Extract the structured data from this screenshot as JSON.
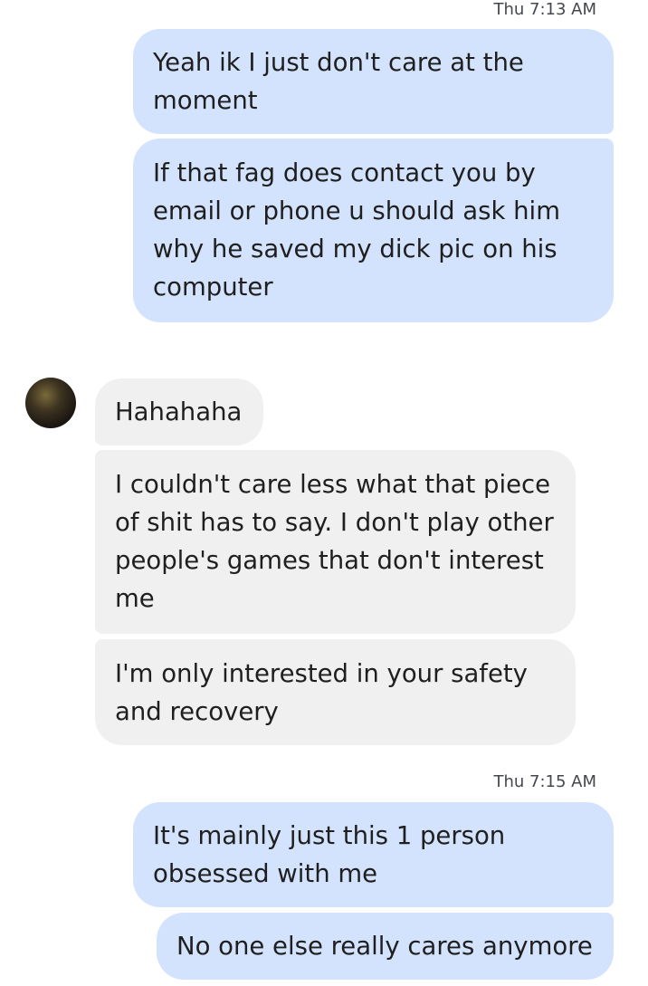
{
  "conversation": {
    "timestamps": [
      "Thu 7:13 AM",
      "Thu 7:15 AM"
    ],
    "messages": [
      {
        "direction": "outgoing",
        "text": "Yeah ik I just don't care at the moment"
      },
      {
        "direction": "outgoing",
        "text": "If that fag does contact you by email or phone u should ask him why he saved my dick pic on his computer"
      },
      {
        "direction": "incoming",
        "text": "Hahahaha"
      },
      {
        "direction": "incoming",
        "text": "I couldn't care less what that piece of shit has to say. I don't play other people's games that don't interest me"
      },
      {
        "direction": "incoming",
        "text": "I'm only interested in your safety and recovery"
      },
      {
        "direction": "outgoing",
        "text": "It's mainly just this 1 person obsessed with me"
      },
      {
        "direction": "outgoing",
        "text": "No one else really cares anymore"
      }
    ],
    "contact_avatar_icon": "contact-avatar-photo"
  },
  "colors": {
    "outgoing_bubble": "#d3e3fd",
    "incoming_bubble": "#f0f0f0",
    "text": "#1f1f1f",
    "timestamp": "#44474e"
  }
}
